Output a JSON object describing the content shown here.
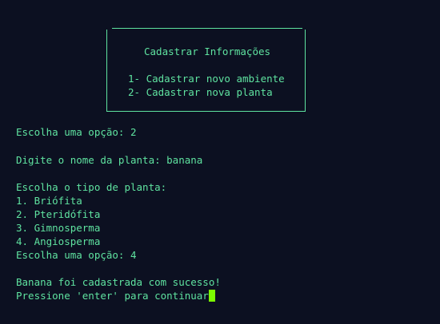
{
  "menu": {
    "title": "Cadastrar Informações",
    "options": [
      "1- Cadastrar novo ambiente",
      "2- Cadastrar nova planta"
    ]
  },
  "session": {
    "choice_prompt_1": "Escolha uma opção: 2",
    "plant_name_prompt": "Digite o nome da planta: banana",
    "type_prompt": "Escolha o tipo de planta:",
    "types": [
      "1. Briófita",
      "2. Pteridófita",
      "3. Gimnosperma",
      "4. Angiosperma"
    ],
    "choice_prompt_2": "Escolha uma opção: 4",
    "success_message": "Banana foi cadastrada com sucesso!",
    "continue_prompt": "Pressione 'enter' para continuar"
  },
  "colors": {
    "background": "#0c1021",
    "text": "#5fe3a0",
    "cursor": "#7CFC00"
  }
}
